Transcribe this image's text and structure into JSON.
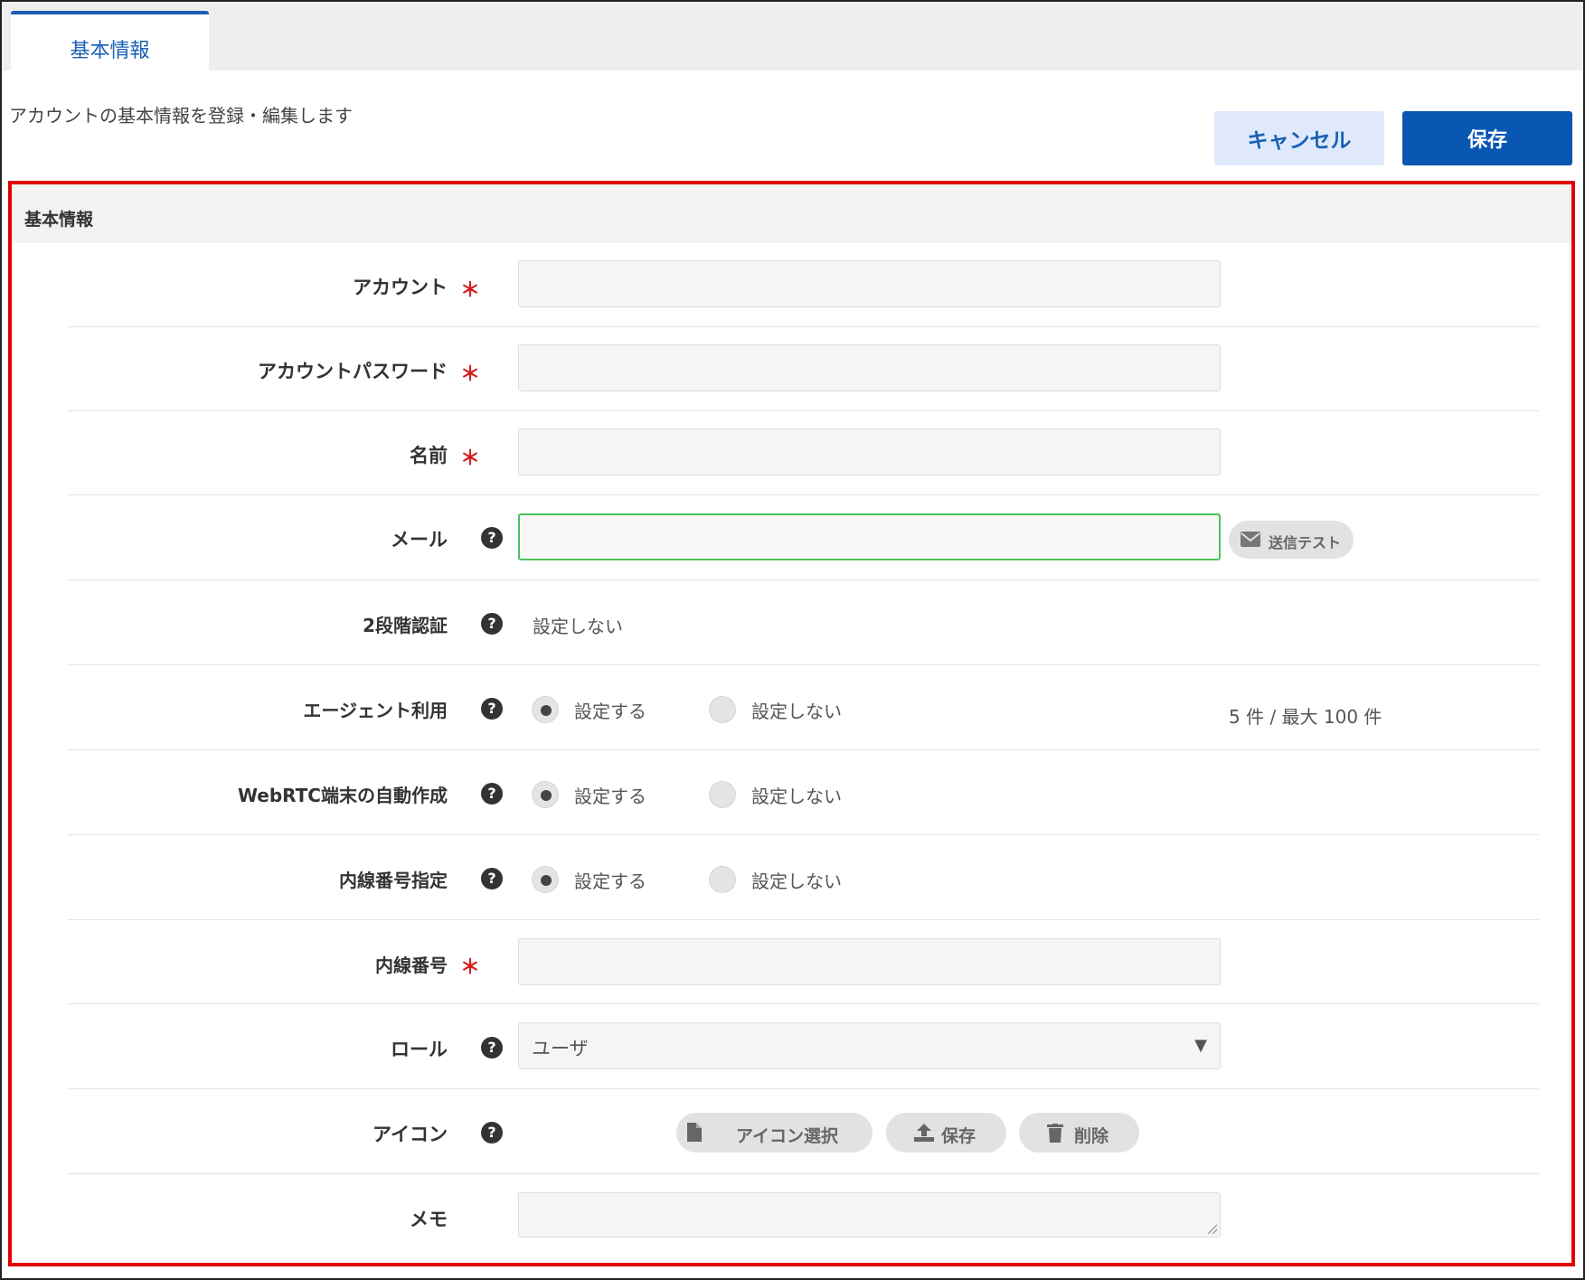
{
  "tab": {
    "label": "基本情報"
  },
  "description": "アカウントの基本情報を登録・編集します",
  "toolbar": {
    "cancel_label": "キャンセル",
    "save_label": "保存"
  },
  "section": {
    "title": "基本情報"
  },
  "required_mark": "＊",
  "help_mark": "?",
  "fields": {
    "account": {
      "label": "アカウント",
      "value": ""
    },
    "password": {
      "label": "アカウントパスワード",
      "value": ""
    },
    "name": {
      "label": "名前",
      "value": ""
    },
    "mail": {
      "label": "メール",
      "value": "",
      "send_test_label": "送信テスト"
    },
    "two_factor": {
      "label": "2段階認証",
      "value": "設定しない"
    },
    "agent": {
      "label": "エージェント利用",
      "on_label": "設定する",
      "off_label": "設定しない",
      "selected": "on",
      "count_text": "5 件 / 最大 100 件"
    },
    "webrtc": {
      "label": "WebRTC端末の自動作成",
      "on_label": "設定する",
      "off_label": "設定しない",
      "selected": "on"
    },
    "ext_spec": {
      "label": "内線番号指定",
      "on_label": "設定する",
      "off_label": "設定しない",
      "selected": "on"
    },
    "extension": {
      "label": "内線番号",
      "value": ""
    },
    "role": {
      "label": "ロール",
      "selected": "ユーザ"
    },
    "icon": {
      "label": "アイコン",
      "select_label": "アイコン選択",
      "save_label": "保存",
      "delete_label": "削除"
    },
    "memo": {
      "label": "メモ",
      "value": ""
    }
  },
  "colors": {
    "accent": "#0a56b3",
    "required": "#d21f1f",
    "highlight_border": "#e10000",
    "valid_border": "#4cc25a"
  }
}
